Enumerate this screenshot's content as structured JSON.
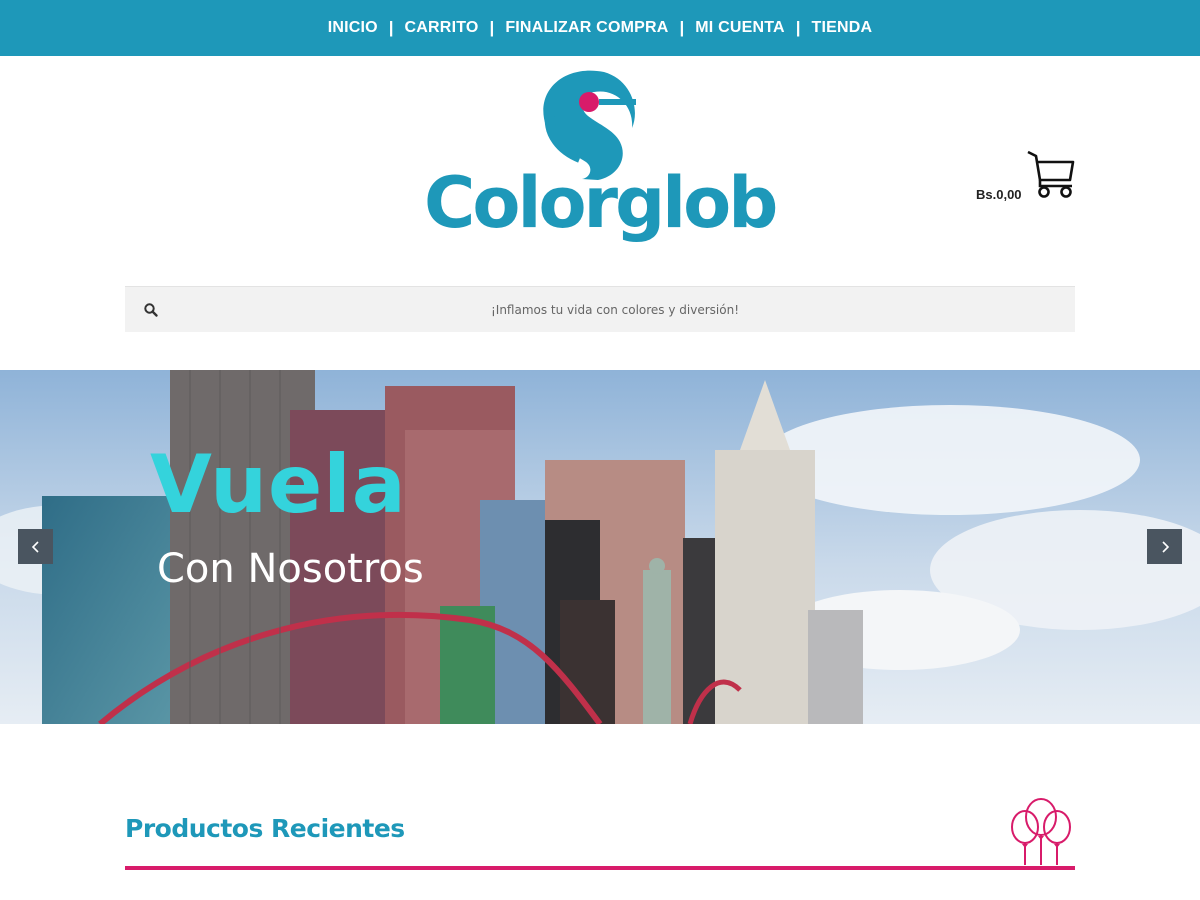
{
  "nav": {
    "items": [
      {
        "label": "INICIO"
      },
      {
        "label": "CARRITO"
      },
      {
        "label": "FINALIZAR COMPRA"
      },
      {
        "label": "MI CUENTA"
      },
      {
        "label": "TIENDA"
      }
    ],
    "separator": "|"
  },
  "header": {
    "logo_text": "Colorglob",
    "cart_total": "Bs.0,00",
    "cart_icon": "shopping-cart-icon"
  },
  "search": {
    "placeholder": "¡Inflamos tu vida con colores y diversión!",
    "icon": "search-icon"
  },
  "hero": {
    "title": "Vuela",
    "subtitle": "Con Nosotros",
    "prev_icon": "chevron-left-icon",
    "next_icon": "chevron-right-icon"
  },
  "recent": {
    "title": "Productos Recientes",
    "icon": "balloons-icon"
  },
  "colors": {
    "brand_blue": "#1e98b9",
    "accent_pink": "#d81b6a",
    "hero_title": "#34d3dc"
  }
}
